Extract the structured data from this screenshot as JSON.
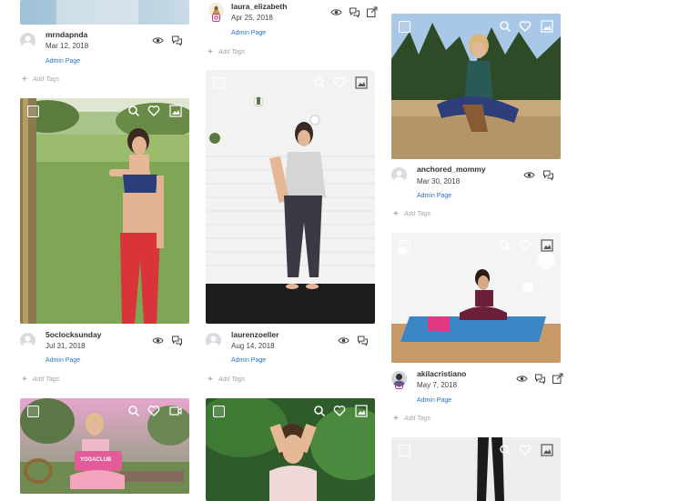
{
  "add_tags_label": "Add Tags",
  "admin_label": "Admin Page",
  "colors": {
    "link": "#2a72c9",
    "accent_instagram": "#c13584"
  },
  "posts": [
    {
      "username": "mrndapnda",
      "date": "Mar 12, 2018",
      "admin": "Admin Page"
    },
    {
      "username": "laura_elizabeth",
      "date": "Apr 25, 2018",
      "admin": "Admin Page",
      "source": "instagram"
    },
    {
      "username": "anchored_mommy",
      "date": "Mar 30, 2018",
      "admin": "Admin Page"
    },
    {
      "username": "5oclocksunday",
      "date": "Jul 31, 2018",
      "admin": "Admin Page"
    },
    {
      "username": "laurenzoeller",
      "date": "Aug 14, 2018",
      "admin": "Admin Page"
    },
    {
      "username": "akilacristiano",
      "date": "May 7, 2018",
      "admin": "Admin Page",
      "source": "instagram"
    }
  ],
  "overlay_text": {
    "yoga_mat_brand": "YOGACLUB"
  }
}
